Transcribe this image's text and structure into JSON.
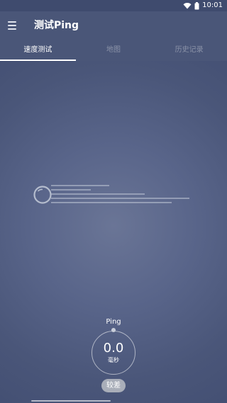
{
  "status_bar": {
    "time": "10:01",
    "icons": [
      "wifi-icon",
      "battery-icon"
    ]
  },
  "app_bar": {
    "title": "测试Ping",
    "menu_icon": "menu-icon"
  },
  "tabs": [
    {
      "label": "速度测试",
      "active": true
    },
    {
      "label": "地图",
      "active": false
    },
    {
      "label": "历史记录",
      "active": false
    }
  ],
  "illustration": {
    "icon": "rocket-speed-icon"
  },
  "ping": {
    "label": "Ping",
    "value": "0.0",
    "unit": "毫秒",
    "quality": "较差"
  },
  "colors": {
    "app_bar": "#4a5678",
    "background": "#4f5b80",
    "tab_indicator": "#ffffff",
    "badge": "#a9aeb9"
  }
}
